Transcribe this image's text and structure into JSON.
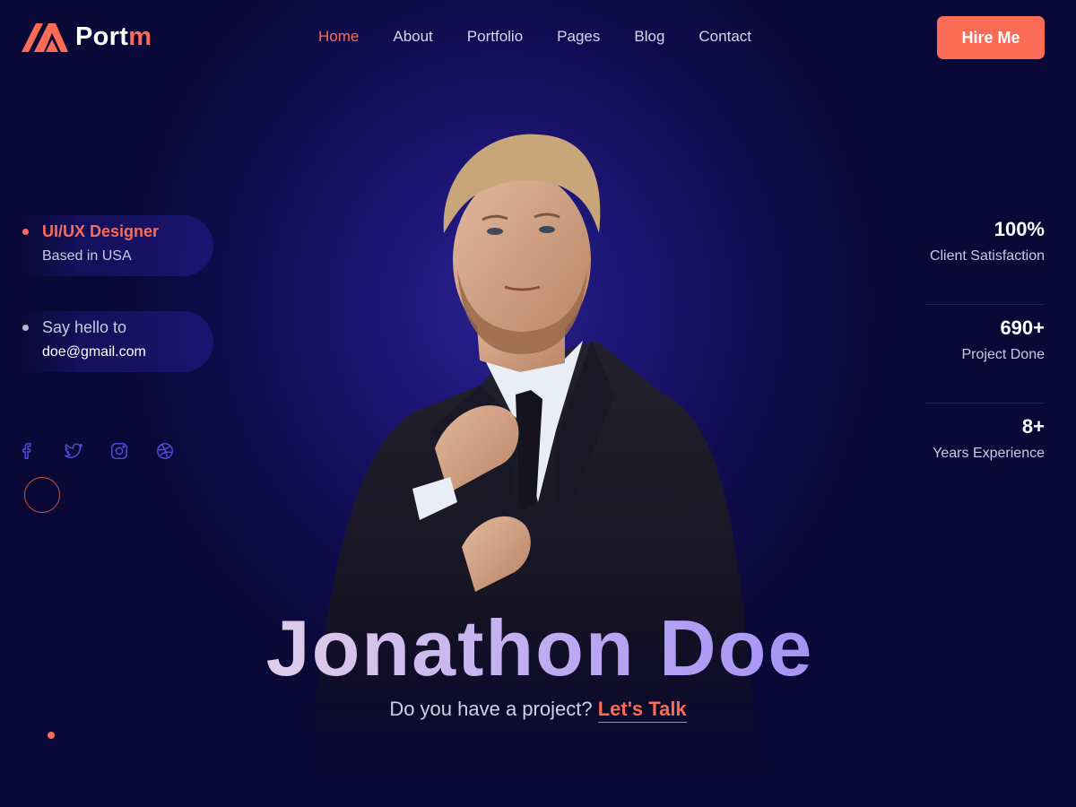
{
  "logo": {
    "text_main": "Port",
    "text_accent": "m"
  },
  "nav": {
    "items": [
      {
        "label": "Home",
        "active": true
      },
      {
        "label": "About"
      },
      {
        "label": "Portfolio"
      },
      {
        "label": "Pages"
      },
      {
        "label": "Blog"
      },
      {
        "label": "Contact"
      }
    ]
  },
  "header": {
    "hire_label": "Hire Me"
  },
  "info": {
    "role": "UI/UX Designer",
    "location": "Based in USA",
    "hello": "Say hello to",
    "email": "doe@gmail.com"
  },
  "socials": [
    "facebook-icon",
    "twitter-icon",
    "instagram-icon",
    "dribbble-icon"
  ],
  "stats": [
    {
      "value": "100%",
      "label": "Client Satisfaction"
    },
    {
      "value": "690+",
      "label": "Project Done"
    },
    {
      "value": "8+",
      "label": "Years Experience"
    }
  ],
  "hero": {
    "name": "Jonathon Doe",
    "question": "Do you have a project?",
    "cta": "Let's Talk"
  },
  "colors": {
    "accent": "#fb6b55",
    "background": "#0a0836",
    "glow": "#29208e"
  }
}
